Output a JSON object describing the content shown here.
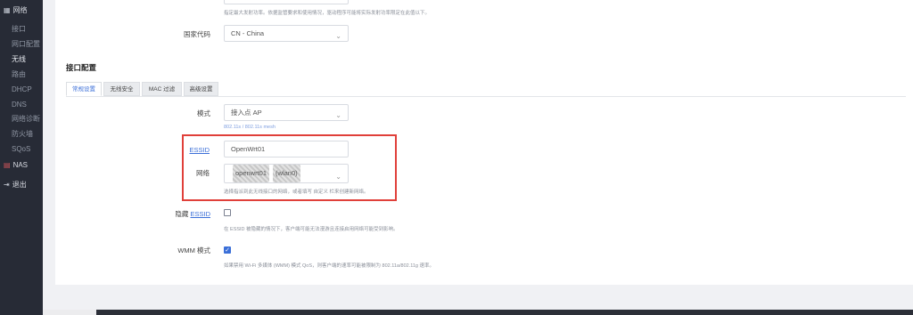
{
  "sidebar": {
    "network_group": "网络",
    "items": [
      "接口",
      "网口配置",
      "无线",
      "路由",
      "DHCP",
      "DNS",
      "网络诊断",
      "防火墙",
      "SQoS"
    ],
    "nas": "NAS",
    "logout": "退出"
  },
  "top": {
    "hint": "指定最大发射功率。依据监管要求和使用情况，驱动程序可能将实际发射功率限定在此值以下。",
    "country_label": "国家代码",
    "country_value": "CN - China"
  },
  "section": {
    "title": "接口配置",
    "tabs": [
      "常规设置",
      "无线安全",
      "MAC 过滤",
      "高级设置"
    ]
  },
  "form": {
    "mode_label": "模式",
    "mode_value": "接入点 AP",
    "mode_hint": "802.11s / 802.11s mesh",
    "essid_label": "ESSID",
    "essid_value": "OpenWrt01",
    "network_label": "网络",
    "network_value_a": "openwrt01",
    "network_value_b": "(wlan0)",
    "network_hint": "选择指派到此无线接口的网络，或者填写 自定义 栏来创建新网络。",
    "hidden_prefix": "隐藏",
    "hidden_link": "ESSID",
    "hidden_hint": "在 ESSID 被隐藏的情况下，客户端可能无法漫游且连接启用网络可能受到影响。",
    "wmm_label": "WMM 模式",
    "wmm_hint": "如果禁用 Wi-Fi 多媒体 (WMM) 模式 QoS，则客户端的速率可能被限制为 802.11a/802.11g 速率。"
  },
  "colors": {
    "accent": "#3b6fd8",
    "highlight": "#e0403a",
    "sidebar": "#272b36"
  },
  "icons": {
    "chevron": "chevron-down-icon",
    "check": "check-icon"
  }
}
